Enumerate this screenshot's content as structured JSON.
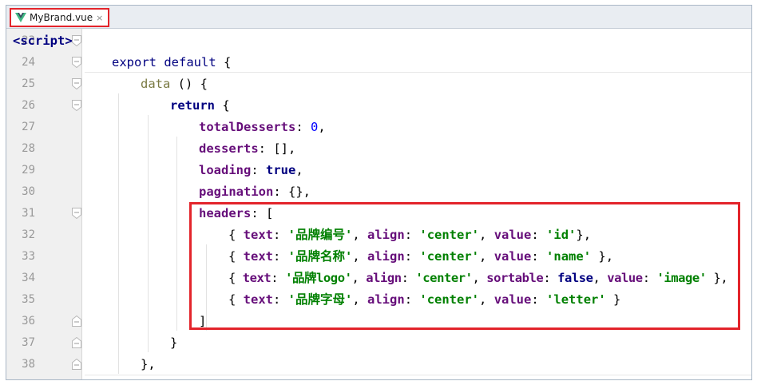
{
  "tab": {
    "filename": "MyBrand.vue",
    "close_glyph": "×",
    "icon": "vue-icon"
  },
  "colors": {
    "highlight": "#e3242b",
    "keyword": "#000080",
    "property": "#660e7a",
    "string": "#008000",
    "number": "#0000ff"
  },
  "lines": [
    {
      "n": "23",
      "fold": "open"
    },
    {
      "n": "24",
      "fold": "open"
    },
    {
      "n": "25",
      "fold": "open"
    },
    {
      "n": "26",
      "fold": "open"
    },
    {
      "n": "27",
      "fold": ""
    },
    {
      "n": "28",
      "fold": ""
    },
    {
      "n": "29",
      "fold": ""
    },
    {
      "n": "30",
      "fold": ""
    },
    {
      "n": "31",
      "fold": "open"
    },
    {
      "n": "32",
      "fold": ""
    },
    {
      "n": "33",
      "fold": ""
    },
    {
      "n": "34",
      "fold": ""
    },
    {
      "n": "35",
      "fold": ""
    },
    {
      "n": "36",
      "fold": "close"
    },
    {
      "n": "37",
      "fold": "close"
    },
    {
      "n": "38",
      "fold": "close"
    }
  ],
  "code": {
    "l23": {
      "lt": "<",
      "tag": "script",
      "gt": ">"
    },
    "l24": {
      "export": "export",
      "default": "default",
      "brace": " {"
    },
    "l25": {
      "fn": "data",
      "rest": " () {"
    },
    "l26": {
      "ret": "return",
      "brace": " {"
    },
    "l27": {
      "key": "totalDesserts",
      "colon": ": ",
      "val": "0",
      "end": ","
    },
    "l28": {
      "key": "desserts",
      "rest": ": [],"
    },
    "l29": {
      "key": "loading",
      "colon": ": ",
      "val": "true",
      "end": ","
    },
    "l30": {
      "key": "pagination",
      "rest": ": {},"
    },
    "l31": {
      "key": "headers",
      "rest": ": ["
    },
    "l32": {
      "o": "{ ",
      "k1": "text",
      "c1": ": ",
      "v1": "'品牌编号'",
      "s1": ", ",
      "k2": "align",
      "c2": ": ",
      "v2": "'center'",
      "s2": ", ",
      "k3": "value",
      "c3": ": ",
      "v3": "'id'",
      "end": "},"
    },
    "l33": {
      "o": "{ ",
      "k1": "text",
      "c1": ": ",
      "v1": "'品牌名称'",
      "s1": ", ",
      "k2": "align",
      "c2": ": ",
      "v2": "'center'",
      "s2": ", ",
      "k3": "value",
      "c3": ": ",
      "v3": "'name'",
      "end": " },"
    },
    "l34": {
      "o": "{ ",
      "k1": "text",
      "c1": ": ",
      "v1": "'品牌logo'",
      "s1": ", ",
      "k2": "align",
      "c2": ": ",
      "v2": "'center'",
      "s2": ", ",
      "k4": "sortable",
      "c4": ": ",
      "v4": "false",
      "s4": ", ",
      "k3": "value",
      "c3": ": ",
      "v3": "'image'",
      "end": " },"
    },
    "l35": {
      "o": "{ ",
      "k1": "text",
      "c1": ": ",
      "v1": "'品牌字母'",
      "s1": ", ",
      "k2": "align",
      "c2": ": ",
      "v2": "'center'",
      "s2": ", ",
      "k3": "value",
      "c3": ": ",
      "v3": "'letter'",
      "end": " }"
    },
    "l36": {
      "text": "]"
    },
    "l37": {
      "text": "}"
    },
    "l38": {
      "text": "},"
    }
  }
}
